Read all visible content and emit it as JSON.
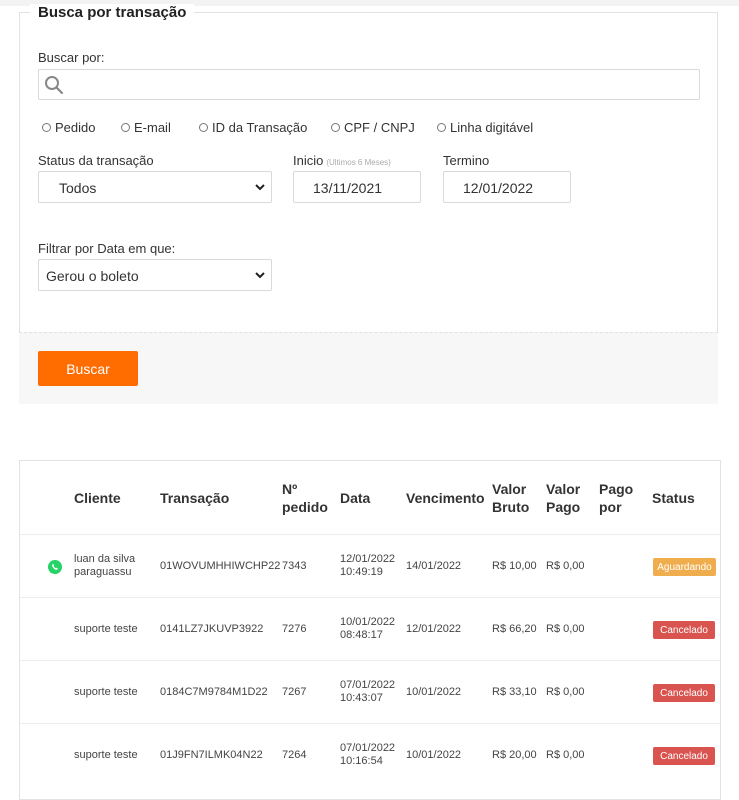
{
  "form": {
    "title": "Busca por transação",
    "search_label": "Buscar por:",
    "search_value": "",
    "radio_options": [
      "Pedido",
      "E-mail",
      "ID da Transação",
      "CPF / CNPJ",
      "Linha digitável"
    ],
    "status_label": "Status da transação",
    "status_value": "Todos",
    "start_label": "Inicio",
    "start_hint": "(Ultimos 6 Meses)",
    "start_value": "13/11/2021",
    "end_label": "Termino",
    "end_value": "12/01/2022",
    "date_filter_label": "Filtrar por Data em que:",
    "date_filter_value": "Gerou o boleto",
    "submit_label": "Buscar"
  },
  "table": {
    "headers": {
      "cliente": "Cliente",
      "transacao": "Transação",
      "pedido_1": "Nº",
      "pedido_2": "pedido",
      "data": "Data",
      "vencimento": "Vencimento",
      "bruto_1": "Valor",
      "bruto_2": "Bruto",
      "pago_1": "Valor",
      "pago_2": "Pago",
      "pagopor_1": "Pago",
      "pagopor_2": "por",
      "status": "Status"
    },
    "rows": [
      {
        "cliente_1": "luan da silva",
        "cliente_2": "paraguassu",
        "transacao": "01WOVUMHHIWCHP22",
        "pedido": "7343",
        "data_1": "12/01/2022",
        "data_2": "10:49:19",
        "vencimento": "14/01/2022",
        "bruto": "R$ 10,00",
        "pago": "R$ 0,00",
        "status": "Aguardando",
        "status_color": "#f0ad4e",
        "whatsapp": true
      },
      {
        "cliente_1": "suporte teste",
        "cliente_2": "",
        "transacao": "0141LZ7JKUVP3922",
        "pedido": "7276",
        "data_1": "10/01/2022",
        "data_2": "08:48:17",
        "vencimento": "12/01/2022",
        "bruto": "R$ 66,20",
        "pago": "R$ 0,00",
        "status": "Cancelado",
        "status_color": "#d9534f",
        "whatsapp": false
      },
      {
        "cliente_1": "suporte teste",
        "cliente_2": "",
        "transacao": "0184C7M9784M1D22",
        "pedido": "7267",
        "data_1": "07/01/2022",
        "data_2": "10:43:07",
        "vencimento": "10/01/2022",
        "bruto": "R$ 33,10",
        "pago": "R$ 0,00",
        "status": "Cancelado",
        "status_color": "#d9534f",
        "whatsapp": false
      },
      {
        "cliente_1": "suporte teste",
        "cliente_2": "",
        "transacao": "01J9FN7ILMK04N22",
        "pedido": "7264",
        "data_1": "07/01/2022",
        "data_2": "10:16:54",
        "vencimento": "10/01/2022",
        "bruto": "R$ 20,00",
        "pago": "R$ 0,00",
        "status": "Cancelado",
        "status_color": "#d9534f",
        "whatsapp": false
      }
    ]
  },
  "colors": {
    "primary_button": "#ff6d00",
    "status_pending": "#f0ad4e",
    "status_cancelled": "#d9534f",
    "whatsapp": "#25d366"
  },
  "icons": {
    "search": "search-icon",
    "whatsapp": "whatsapp-icon",
    "select_chevron": "chevron-down-icon"
  }
}
